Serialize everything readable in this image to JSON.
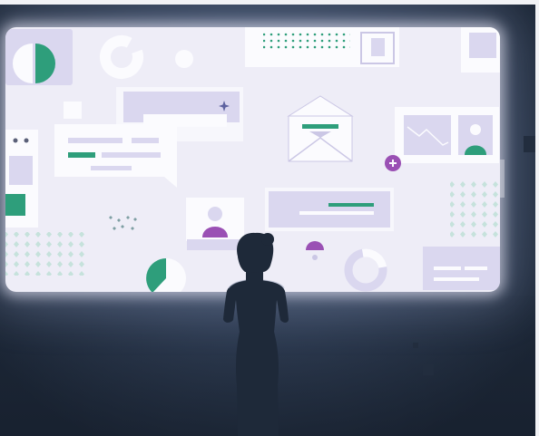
{
  "colors": {
    "bg_center": "#465871",
    "bg_mid": "#33425a",
    "bg_edge": "#1d2838",
    "screen": "#eeedf7",
    "card": "#fbfbfe",
    "lavender": "#dad7ef",
    "lavender_dark": "#cbc7e5",
    "green": "#2e9e7b",
    "green_light": "#a6d8c6",
    "purple": "#9a50b4",
    "sparkle": "#5d62a0",
    "dot_dark": "#5a6078",
    "dot_teal": "#7f9fa4",
    "silhouette": "#1e2939",
    "dark_block": "#222d3e",
    "frame": "#f2f3f6"
  },
  "icons": [
    "pie-chart-icon",
    "donut-chart-icon",
    "envelope-icon",
    "speech-bubble-icon",
    "image-placeholder-icon",
    "user-avatar-icon",
    "add-circle-icon",
    "sparkle-icon"
  ]
}
